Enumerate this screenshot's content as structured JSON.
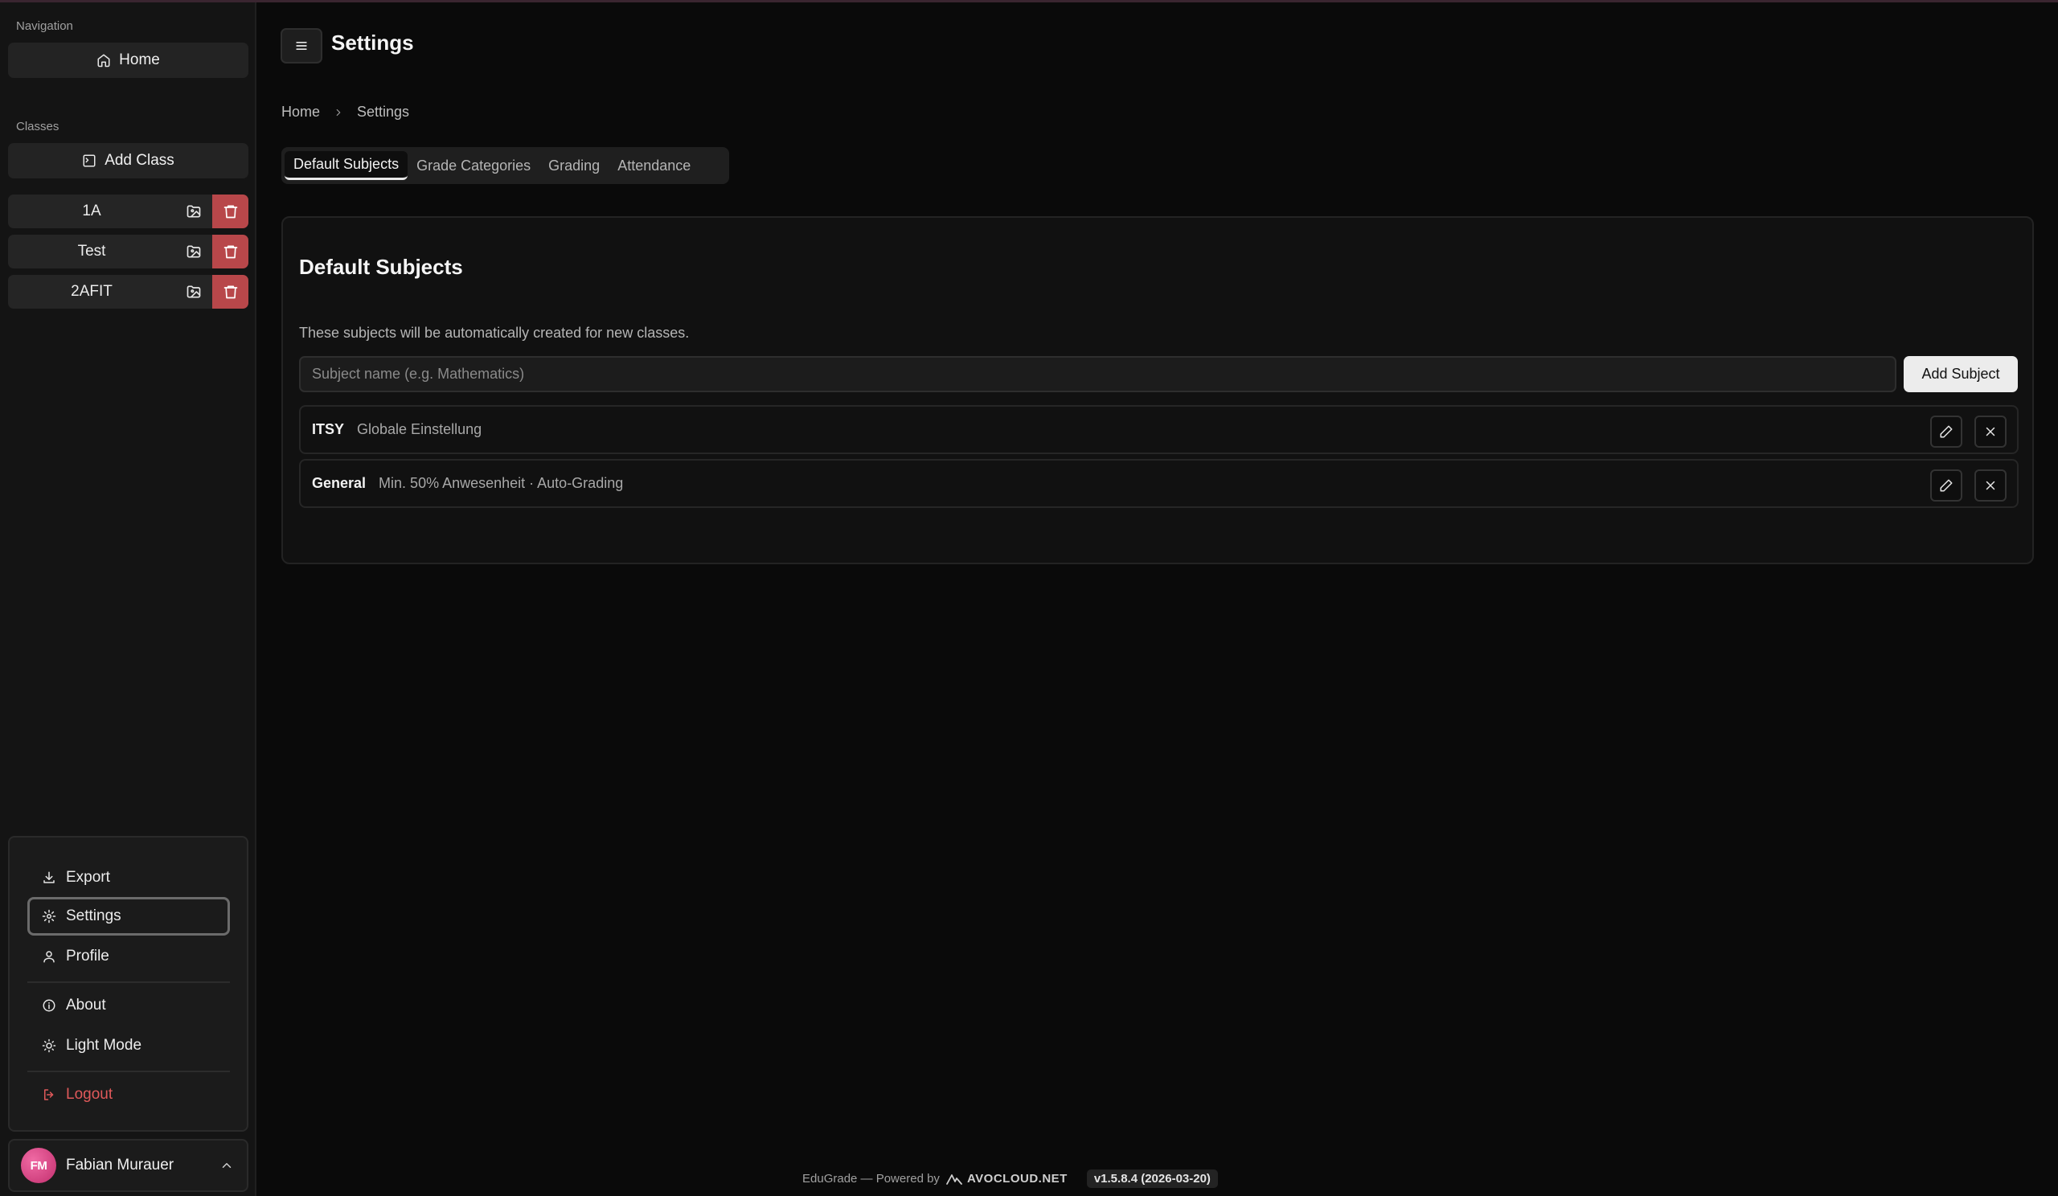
{
  "app": {
    "title": "Settings"
  },
  "sidebar": {
    "nav_label": "Navigation",
    "home_label": "Home",
    "classes_label": "Classes",
    "add_class_label": "Add Class",
    "classes": [
      {
        "name": "1A"
      },
      {
        "name": "Test"
      },
      {
        "name": "2AFIT"
      }
    ],
    "menu": {
      "export": "Export",
      "settings": "Settings",
      "profile": "Profile",
      "about": "About",
      "light_mode": "Light Mode",
      "logout": "Logout"
    },
    "user": {
      "initials": "FM",
      "name": "Fabian Murauer"
    }
  },
  "header": {
    "title": "Settings"
  },
  "breadcrumb": {
    "home": "Home",
    "current": "Settings"
  },
  "tabs": [
    {
      "label": "Default Subjects",
      "active": true
    },
    {
      "label": "Grade Categories",
      "active": false
    },
    {
      "label": "Grading",
      "active": false
    },
    {
      "label": "Attendance",
      "active": false
    }
  ],
  "card": {
    "title": "Default Subjects",
    "description": "These subjects will be automatically created for new classes.",
    "input_placeholder": "Subject name (e.g. Mathematics)",
    "add_button": "Add Subject",
    "subjects": [
      {
        "name": "ITSY",
        "meta": "Globale Einstellung"
      },
      {
        "name": "General",
        "meta": "Min. 50% Anwesenheit · Auto-Grading"
      }
    ]
  },
  "footer": {
    "text": "EduGrade — Powered by",
    "brand": "AVOCLOUD.NET",
    "version": "v1.5.8.4 (2026-03-20)"
  },
  "colors": {
    "background": "#0a0a0a",
    "sidebar": "#141414",
    "danger": "#b8474a",
    "logout": "#e0595a",
    "avatar": "#d9417f"
  }
}
